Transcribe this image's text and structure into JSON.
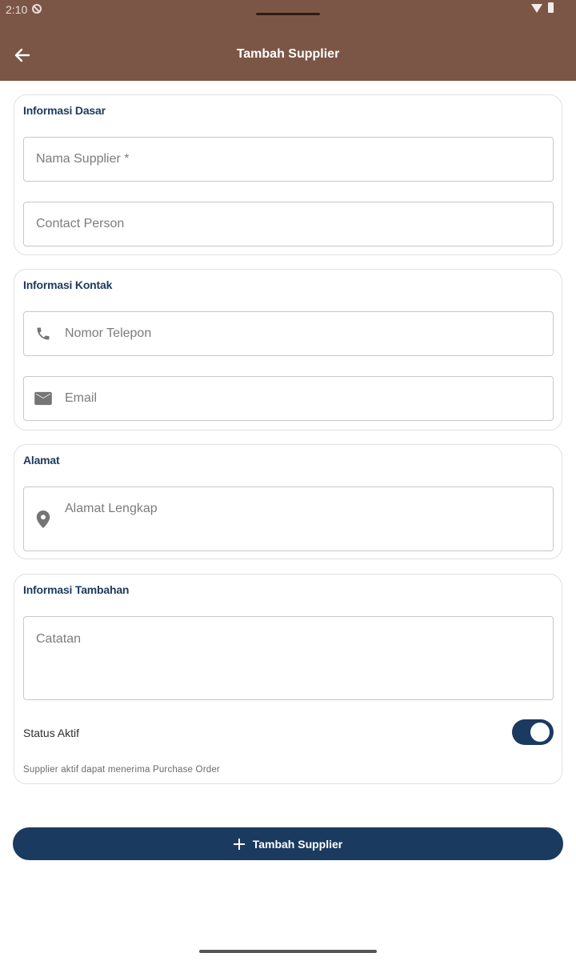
{
  "status_bar": {
    "time": "2:10"
  },
  "app_bar": {
    "title": "Tambah Supplier"
  },
  "sections": {
    "basic": {
      "title": "Informasi Dasar",
      "name_placeholder": "Nama Supplier *",
      "contact_placeholder": "Contact Person"
    },
    "contact": {
      "title": "Informasi Kontak",
      "phone_placeholder": "Nomor Telepon",
      "email_placeholder": "Email"
    },
    "address": {
      "title": "Alamat",
      "address_placeholder": "Alamat Lengkap"
    },
    "extra": {
      "title": "Informasi Tambahan",
      "notes_placeholder": "Catatan",
      "status_label": "Status Aktif",
      "status_on": true,
      "helper": "Supplier aktif dapat menerima Purchase Order"
    }
  },
  "submit_label": "Tambah Supplier",
  "colors": {
    "app_bar": "#7b5646",
    "primary": "#1b3a5f",
    "section_title": "#1c3a5e"
  }
}
